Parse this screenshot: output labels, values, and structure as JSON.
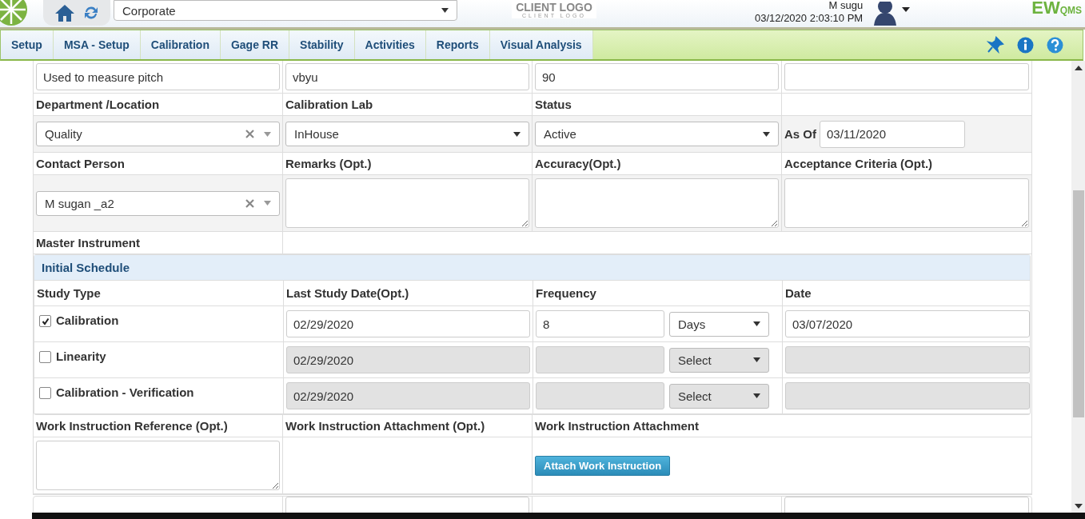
{
  "header": {
    "org_select": "Corporate",
    "client_logo": {
      "title": "CLIENT LOGO",
      "subtitle": "CLIENT LOGO"
    },
    "user": "M sugu",
    "datetime": "03/12/2020 2:03:10 PM",
    "brand": {
      "main": "EW",
      "sub": "QMS"
    }
  },
  "nav": {
    "tabs": [
      {
        "label": "Setup",
        "selected": false
      },
      {
        "label": "MSA - Setup",
        "selected": false
      },
      {
        "label": "Calibration",
        "selected": false
      },
      {
        "label": "Gage RR",
        "selected": false
      },
      {
        "label": "Stability",
        "selected": false
      },
      {
        "label": "Activities",
        "selected": false
      },
      {
        "label": "Reports",
        "selected": false
      },
      {
        "label": "Visual Analysis",
        "selected": false
      }
    ]
  },
  "form": {
    "top_inputs": [
      {
        "value": "Used to measure pitch"
      },
      {
        "value": "vbyu"
      },
      {
        "value": "90"
      }
    ],
    "department": {
      "label": "Department /Location",
      "value": "Quality"
    },
    "calibration_lab": {
      "label": "Calibration Lab",
      "value": "InHouse"
    },
    "status": {
      "label": "Status",
      "value": "Active"
    },
    "as_of": {
      "label": "As Of",
      "value": "03/11/2020"
    },
    "contact_person": {
      "label": "Contact Person",
      "value": "M sugan _a2"
    },
    "remarks": {
      "label": "Remarks (Opt.)"
    },
    "accuracy": {
      "label": "Accuracy(Opt.)"
    },
    "acceptance_criteria": {
      "label": "Acceptance Criteria (Opt.)"
    },
    "master_instrument": {
      "label": "Master Instrument"
    },
    "schedule": {
      "title": "Initial Schedule",
      "columns": [
        "Study Type",
        "Last Study Date(Opt.)",
        "Frequency",
        "Date"
      ],
      "rows": [
        {
          "label": "Calibration",
          "checked": true,
          "disabled": false,
          "last_date": "02/29/2020",
          "frequency": "8",
          "unit": "Days",
          "date": "03/07/2020"
        },
        {
          "label": "Linearity",
          "checked": false,
          "disabled": true,
          "last_date": "02/29/2020",
          "unit": "Select"
        },
        {
          "label": "Calibration - Verification",
          "checked": false,
          "disabled": true,
          "last_date": "02/29/2020",
          "unit": "Select"
        }
      ]
    },
    "work_instruction": {
      "reference_label": "Work Instruction Reference (Opt.)",
      "attachment_opt_label": "Work Instruction Attachment (Opt.)",
      "attachment_label": "Work Instruction Attachment",
      "button": "Attach Work Instruction"
    }
  }
}
